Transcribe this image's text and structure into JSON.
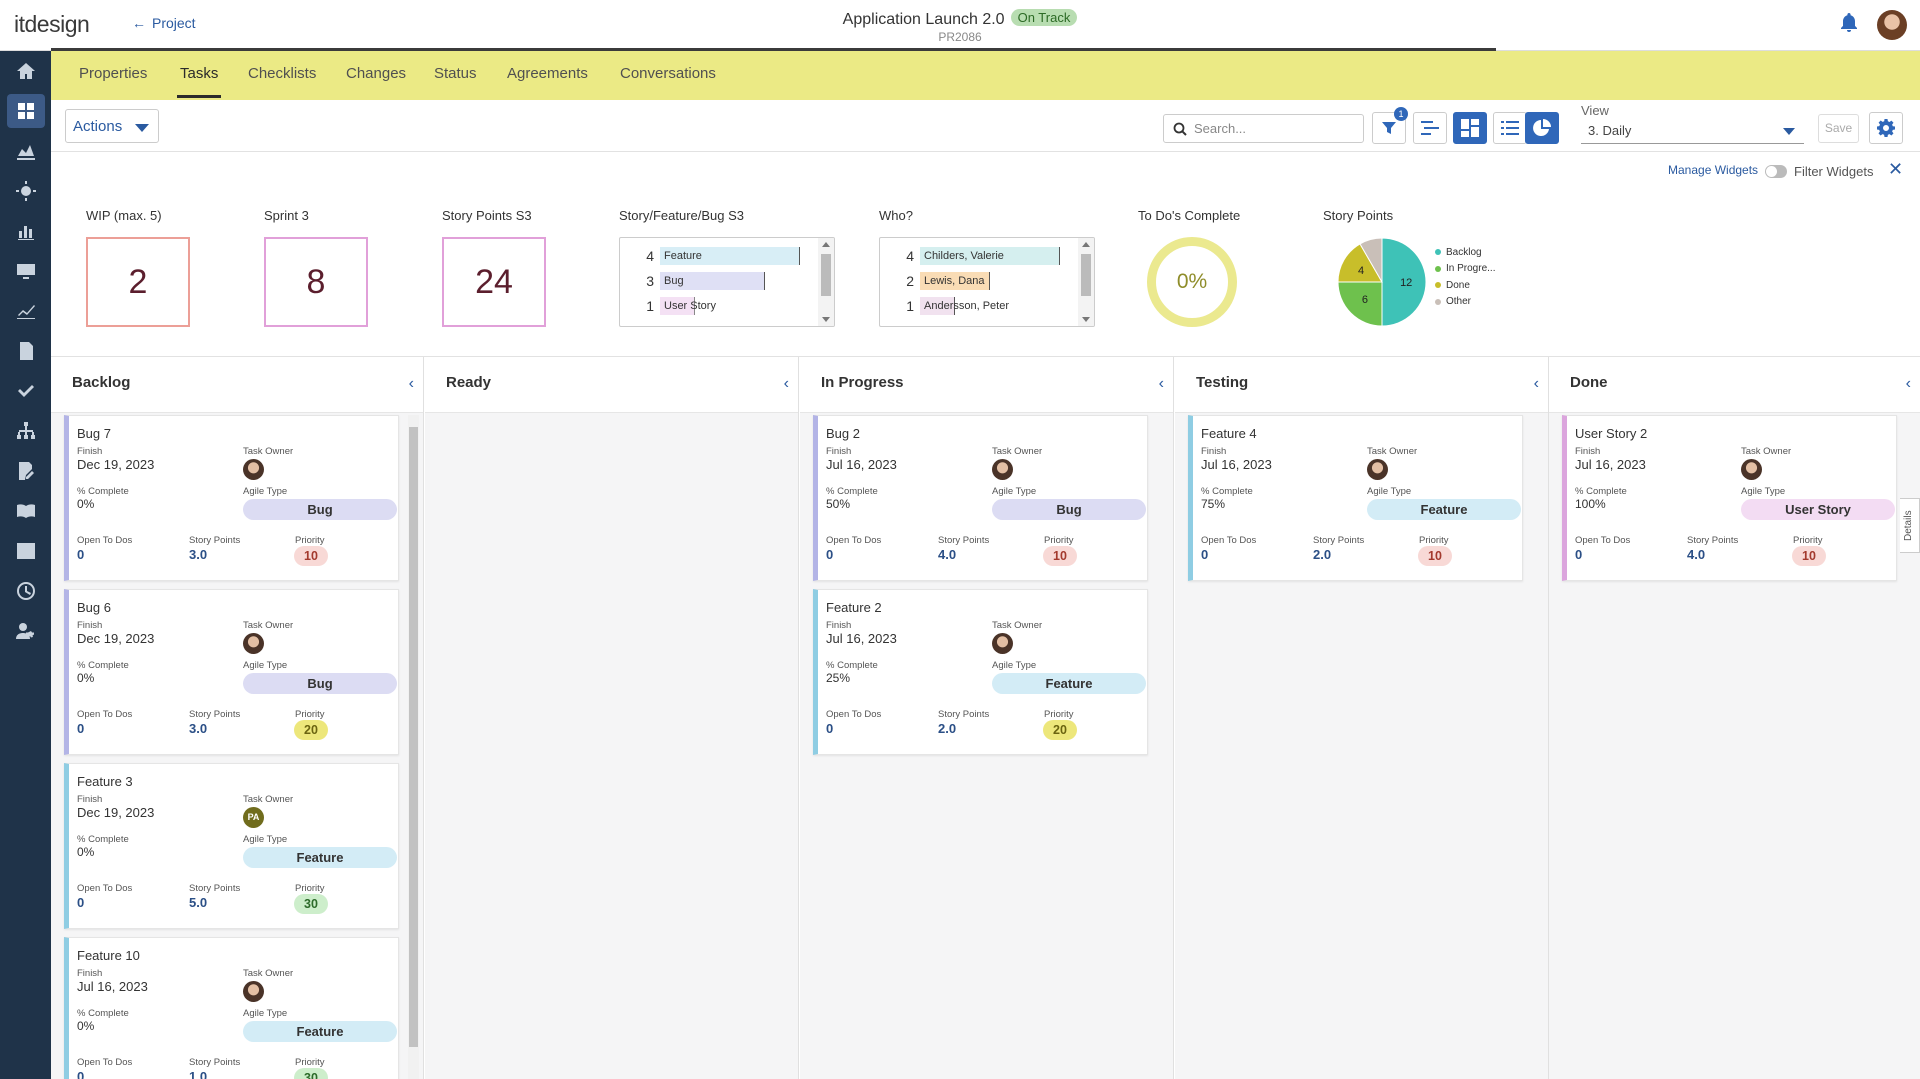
{
  "header": {
    "logo": "itdesign",
    "back_label": "Project",
    "project_name": "Application Launch 2.0",
    "status_badge": "On Track",
    "project_code": "PR2086"
  },
  "tabs": [
    {
      "label": "Properties"
    },
    {
      "label": "Tasks",
      "active": true
    },
    {
      "label": "Checklists"
    },
    {
      "label": "Changes"
    },
    {
      "label": "Status"
    },
    {
      "label": "Agreements"
    },
    {
      "label": "Conversations"
    }
  ],
  "toolbar": {
    "actions_label": "Actions",
    "search_placeholder": "Search...",
    "filter_count": "1",
    "view_label": "View",
    "view_value": "3. Daily",
    "save_label": "Save"
  },
  "widgets_bar": {
    "manage_label": "Manage Widgets",
    "filter_label": "Filter Widgets",
    "close_glyph": "✕"
  },
  "widgets": {
    "wip": {
      "title": "WIP (max. 5)",
      "value": "2"
    },
    "sprint": {
      "title": "Sprint 3",
      "value": "8"
    },
    "story_points_s3": {
      "title": "Story Points S3",
      "value": "24"
    },
    "type_breakdown": {
      "title": "Story/Feature/Bug S3",
      "rows": [
        {
          "count": "4",
          "label": "Feature",
          "color": "#d8eef6"
        },
        {
          "count": "3",
          "label": "Bug",
          "color": "#dfe0f5"
        },
        {
          "count": "1",
          "label": "User Story",
          "color": "#f4e1f4"
        }
      ]
    },
    "who": {
      "title": "Who?",
      "rows": [
        {
          "count": "4",
          "label": "Childers, Valerie",
          "color": "#d5efef"
        },
        {
          "count": "2",
          "label": "Lewis, Dana",
          "color": "#f9dcb5"
        },
        {
          "count": "1",
          "label": "Andersson, Peter",
          "color": "#f1e2ef"
        }
      ]
    },
    "todos": {
      "title": "To Do's Complete",
      "value": "0%"
    },
    "story_points": {
      "title": "Story Points",
      "legend": [
        {
          "label": "Backlog",
          "color": "#3ec2b7"
        },
        {
          "label": "In Progre...",
          "color": "#6ec14d"
        },
        {
          "label": "Done",
          "color": "#c8be2a"
        },
        {
          "label": "Other",
          "color": "#c9bfb8"
        }
      ],
      "slices": [
        {
          "label": "Backlog",
          "value": 12,
          "color": "#3ec2b7"
        },
        {
          "label": "In Progress",
          "value": 6,
          "color": "#6ec14d"
        },
        {
          "label": "Done",
          "value": 4,
          "color": "#c8be2a"
        },
        {
          "label": "Other",
          "value": 2,
          "color": "#c9bfb8"
        }
      ],
      "slice_labels": [
        "12",
        "6",
        "4"
      ]
    }
  },
  "columns": [
    {
      "title": "Backlog"
    },
    {
      "title": "Ready"
    },
    {
      "title": "In Progress"
    },
    {
      "title": "Testing"
    },
    {
      "title": "Done"
    }
  ],
  "card_labels": {
    "finish": "Finish",
    "task_owner": "Task Owner",
    "complete": "% Complete",
    "agile_type": "Agile Type",
    "open_todos": "Open To Dos",
    "story_points": "Story Points",
    "priority": "Priority"
  },
  "cards": {
    "backlog": [
      {
        "title": "Bug 7",
        "finish": "Dec 19, 2023",
        "complete": "0%",
        "type": "Bug",
        "todos": "0",
        "points": "3.0",
        "priority": "10"
      },
      {
        "title": "Bug 6",
        "finish": "Dec 19, 2023",
        "complete": "0%",
        "type": "Bug",
        "todos": "0",
        "points": "3.0",
        "priority": "20"
      },
      {
        "title": "Feature 3",
        "finish": "Dec 19, 2023",
        "complete": "0%",
        "type": "Feature",
        "todos": "0",
        "points": "5.0",
        "priority": "30",
        "owner_initials": "PA"
      },
      {
        "title": "Feature 10",
        "finish": "Jul 16, 2023",
        "complete": "0%",
        "type": "Feature",
        "todos": "0",
        "points": "1.0",
        "priority": "30"
      }
    ],
    "in_progress": [
      {
        "title": "Bug 2",
        "finish": "Jul 16, 2023",
        "complete": "50%",
        "type": "Bug",
        "todos": "0",
        "points": "4.0",
        "priority": "10"
      },
      {
        "title": "Feature 2",
        "finish": "Jul 16, 2023",
        "complete": "25%",
        "type": "Feature",
        "todos": "0",
        "points": "2.0",
        "priority": "20"
      }
    ],
    "testing": [
      {
        "title": "Feature 4",
        "finish": "Jul 16, 2023",
        "complete": "75%",
        "type": "Feature",
        "todos": "0",
        "points": "2.0",
        "priority": "10"
      }
    ],
    "done": [
      {
        "title": "User Story 2",
        "finish": "Jul 16, 2023",
        "complete": "100%",
        "type": "User Story",
        "todos": "0",
        "points": "4.0",
        "priority": "10"
      }
    ]
  },
  "details_tab": "Details",
  "colors": {
    "sidebar": "#1f3349",
    "tabbar": "#ebea85",
    "accent": "#2f67b9",
    "bug": "#dcdcf3",
    "feature": "#d3ecf6",
    "user_story": "#f3dcf3",
    "prio_10": "#f8d9d6",
    "prio_20": "#ede77b",
    "prio_30": "#cdeecb"
  }
}
